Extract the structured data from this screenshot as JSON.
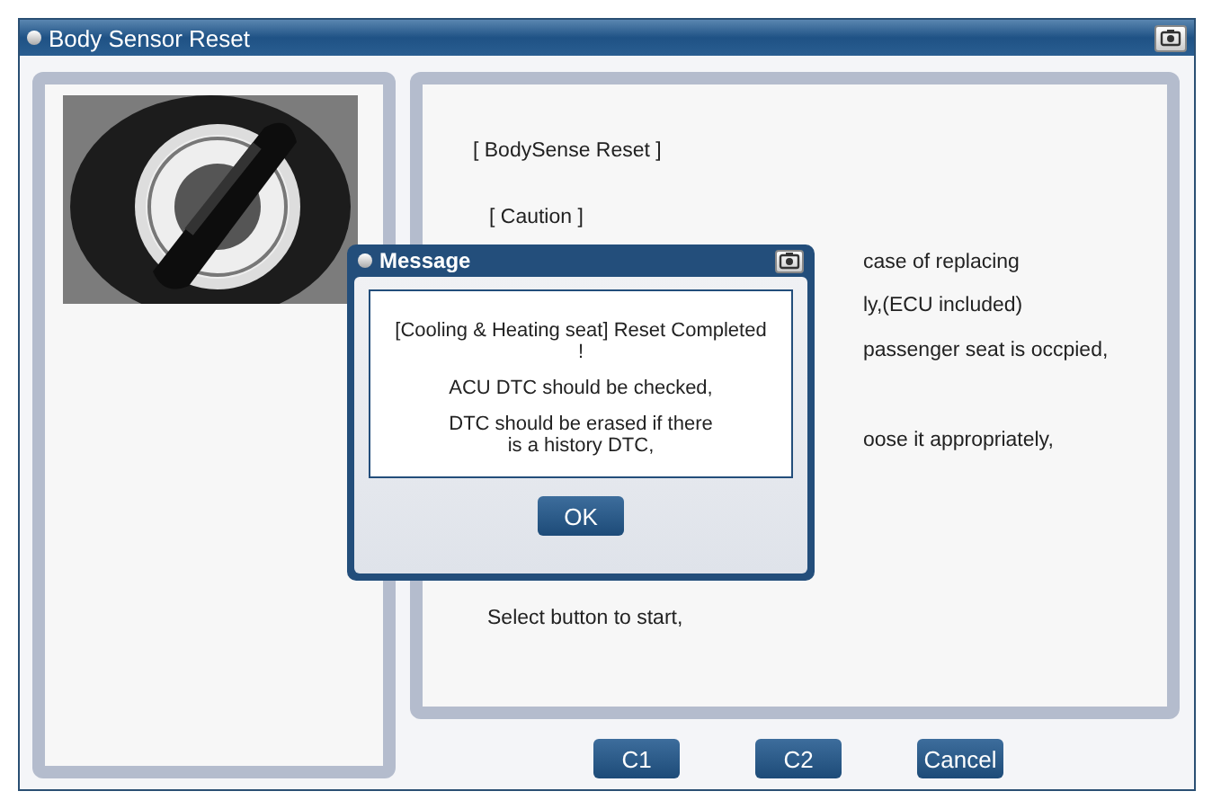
{
  "window": {
    "title": "Body Sensor Reset"
  },
  "instructions": [
    {
      "text": "[ BodySense Reset ]",
      "kind": "full"
    },
    {
      "text": "[ Caution ]",
      "kind": "full"
    },
    {
      "text": "case of replacing",
      "kind": "partial"
    },
    {
      "text": "ly,(ECU included)",
      "kind": "partial"
    },
    {
      "text": "passenger seat is occpied,",
      "kind": "partial"
    },
    {
      "text": "oose it appropriately,",
      "kind": "partial"
    },
    {
      "text": "Select button to start,",
      "kind": "full"
    }
  ],
  "buttons": [
    "C1",
    "C2",
    "Cancel"
  ],
  "message": {
    "title": "Message",
    "lines": [
      "[Cooling & Heating seat]  Reset Completed\n!",
      "ACU DTC should be checked,",
      "DTC should be erased if there\nis a history DTC,"
    ],
    "button": "OK"
  }
}
